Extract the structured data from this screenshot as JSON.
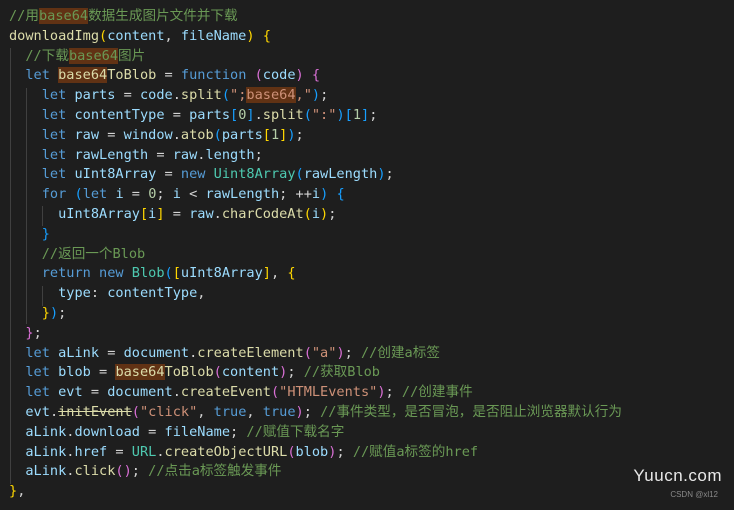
{
  "editor": {
    "theme_colors": {
      "background": "#1e1e1e",
      "keyword": "#569cd6",
      "variable": "#9cdcfe",
      "function": "#dcdcaa",
      "string": "#ce9178",
      "number": "#b5cea8",
      "comment": "#6a9955",
      "search_highlight": "#613214"
    },
    "lines": [
      [
        [
          "c",
          "//用"
        ],
        [
          "c hl",
          "base64"
        ],
        [
          "c",
          "数据生成图片文件并下载"
        ]
      ],
      [
        [
          "f",
          "downloadImg"
        ],
        [
          "b1",
          "("
        ],
        [
          "v",
          "content"
        ],
        [
          "p",
          ", "
        ],
        [
          "v",
          "fileName"
        ],
        [
          "b1",
          ")"
        ],
        [
          "p",
          " "
        ],
        [
          "b1",
          "{"
        ]
      ],
      [
        [
          "p",
          "  "
        ],
        [
          "c",
          "//下载"
        ],
        [
          "c hl",
          "base64"
        ],
        [
          "c",
          "图片"
        ]
      ],
      [
        [
          "p",
          "  "
        ],
        [
          "k",
          "let"
        ],
        [
          "p",
          " "
        ],
        [
          "f hl",
          "base64"
        ],
        [
          "f",
          "ToBlob"
        ],
        [
          "p",
          " = "
        ],
        [
          "k",
          "function"
        ],
        [
          "p",
          " "
        ],
        [
          "b2",
          "("
        ],
        [
          "v",
          "code"
        ],
        [
          "b2",
          ")"
        ],
        [
          "p",
          " "
        ],
        [
          "b2",
          "{"
        ]
      ],
      [
        [
          "p",
          "    "
        ],
        [
          "k",
          "let"
        ],
        [
          "p",
          " "
        ],
        [
          "v",
          "parts"
        ],
        [
          "p",
          " = "
        ],
        [
          "v",
          "code"
        ],
        [
          "p",
          "."
        ],
        [
          "f",
          "split"
        ],
        [
          "b3",
          "("
        ],
        [
          "s",
          "\";"
        ],
        [
          "s hl",
          "base64"
        ],
        [
          "s",
          ",\""
        ],
        [
          "b3",
          ")"
        ],
        [
          "p",
          ";"
        ]
      ],
      [
        [
          "p",
          "    "
        ],
        [
          "k",
          "let"
        ],
        [
          "p",
          " "
        ],
        [
          "v",
          "contentType"
        ],
        [
          "p",
          " = "
        ],
        [
          "v",
          "parts"
        ],
        [
          "b3",
          "["
        ],
        [
          "n",
          "0"
        ],
        [
          "b3",
          "]"
        ],
        [
          "p",
          "."
        ],
        [
          "f",
          "split"
        ],
        [
          "b3",
          "("
        ],
        [
          "s",
          "\":\""
        ],
        [
          "b3",
          ")"
        ],
        [
          "b3",
          "["
        ],
        [
          "n",
          "1"
        ],
        [
          "b3",
          "]"
        ],
        [
          "p",
          ";"
        ]
      ],
      [
        [
          "p",
          "    "
        ],
        [
          "k",
          "let"
        ],
        [
          "p",
          " "
        ],
        [
          "v",
          "raw"
        ],
        [
          "p",
          " = "
        ],
        [
          "v",
          "window"
        ],
        [
          "p",
          "."
        ],
        [
          "f",
          "atob"
        ],
        [
          "b3",
          "("
        ],
        [
          "v",
          "parts"
        ],
        [
          "b1",
          "["
        ],
        [
          "n",
          "1"
        ],
        [
          "b1",
          "]"
        ],
        [
          "b3",
          ")"
        ],
        [
          "p",
          ";"
        ]
      ],
      [
        [
          "p",
          "    "
        ],
        [
          "k",
          "let"
        ],
        [
          "p",
          " "
        ],
        [
          "v",
          "rawLength"
        ],
        [
          "p",
          " = "
        ],
        [
          "v",
          "raw"
        ],
        [
          "p",
          "."
        ],
        [
          "v",
          "length"
        ],
        [
          "p",
          ";"
        ]
      ],
      [
        [
          "p",
          "    "
        ],
        [
          "k",
          "let"
        ],
        [
          "p",
          " "
        ],
        [
          "v",
          "uInt8Array"
        ],
        [
          "p",
          " = "
        ],
        [
          "k",
          "new"
        ],
        [
          "p",
          " "
        ],
        [
          "t",
          "Uint8Array"
        ],
        [
          "b3",
          "("
        ],
        [
          "v",
          "rawLength"
        ],
        [
          "b3",
          ")"
        ],
        [
          "p",
          ";"
        ]
      ],
      [
        [
          "p",
          "    "
        ],
        [
          "k",
          "for"
        ],
        [
          "p",
          " "
        ],
        [
          "b3",
          "("
        ],
        [
          "k",
          "let"
        ],
        [
          "p",
          " "
        ],
        [
          "v",
          "i"
        ],
        [
          "p",
          " = "
        ],
        [
          "n",
          "0"
        ],
        [
          "p",
          "; "
        ],
        [
          "v",
          "i"
        ],
        [
          "p",
          " < "
        ],
        [
          "v",
          "rawLength"
        ],
        [
          "p",
          "; ++"
        ],
        [
          "v",
          "i"
        ],
        [
          "b3",
          ")"
        ],
        [
          "p",
          " "
        ],
        [
          "b3",
          "{"
        ]
      ],
      [
        [
          "p",
          "      "
        ],
        [
          "v",
          "uInt8Array"
        ],
        [
          "b1",
          "["
        ],
        [
          "v",
          "i"
        ],
        [
          "b1",
          "]"
        ],
        [
          "p",
          " = "
        ],
        [
          "v",
          "raw"
        ],
        [
          "p",
          "."
        ],
        [
          "f",
          "charCodeAt"
        ],
        [
          "b1",
          "("
        ],
        [
          "v",
          "i"
        ],
        [
          "b1",
          ")"
        ],
        [
          "p",
          ";"
        ]
      ],
      [
        [
          "p",
          "    "
        ],
        [
          "b3",
          "}"
        ]
      ],
      [
        [
          "p",
          "    "
        ],
        [
          "c",
          "//返回一个Blob"
        ]
      ],
      [
        [
          "p",
          "    "
        ],
        [
          "k",
          "return"
        ],
        [
          "p",
          " "
        ],
        [
          "k",
          "new"
        ],
        [
          "p",
          " "
        ],
        [
          "t",
          "Blob"
        ],
        [
          "b3",
          "("
        ],
        [
          "b1",
          "["
        ],
        [
          "v",
          "uInt8Array"
        ],
        [
          "b1",
          "]"
        ],
        [
          "p",
          ", "
        ],
        [
          "b1",
          "{"
        ]
      ],
      [
        [
          "p",
          "      "
        ],
        [
          "v",
          "type"
        ],
        [
          "p",
          ": "
        ],
        [
          "v",
          "contentType"
        ],
        [
          "p",
          ","
        ]
      ],
      [
        [
          "p",
          "    "
        ],
        [
          "b1",
          "}"
        ],
        [
          "b3",
          ")"
        ],
        [
          "p",
          ";"
        ]
      ],
      [
        [
          "p",
          "  "
        ],
        [
          "b2",
          "}"
        ],
        [
          "p",
          ";"
        ]
      ],
      [
        [
          "p",
          "  "
        ],
        [
          "k",
          "let"
        ],
        [
          "p",
          " "
        ],
        [
          "v",
          "aLink"
        ],
        [
          "p",
          " = "
        ],
        [
          "v",
          "document"
        ],
        [
          "p",
          "."
        ],
        [
          "f",
          "createElement"
        ],
        [
          "b2",
          "("
        ],
        [
          "s",
          "\"a\""
        ],
        [
          "b2",
          ")"
        ],
        [
          "p",
          "; "
        ],
        [
          "c",
          "//创建a标签"
        ]
      ],
      [
        [
          "p",
          "  "
        ],
        [
          "k",
          "let"
        ],
        [
          "p",
          " "
        ],
        [
          "v",
          "blob"
        ],
        [
          "p",
          " = "
        ],
        [
          "f hl",
          "base64"
        ],
        [
          "f",
          "ToBlob"
        ],
        [
          "b2",
          "("
        ],
        [
          "v",
          "content"
        ],
        [
          "b2",
          ")"
        ],
        [
          "p",
          "; "
        ],
        [
          "c",
          "//获取Blob"
        ]
      ],
      [
        [
          "p",
          "  "
        ],
        [
          "k",
          "let"
        ],
        [
          "p",
          " "
        ],
        [
          "v",
          "evt"
        ],
        [
          "p",
          " = "
        ],
        [
          "v",
          "document"
        ],
        [
          "p",
          "."
        ],
        [
          "f",
          "createEvent"
        ],
        [
          "b2",
          "("
        ],
        [
          "s",
          "\"HTMLEvents\""
        ],
        [
          "b2",
          ")"
        ],
        [
          "p",
          "; "
        ],
        [
          "c",
          "//创建事件"
        ]
      ],
      [
        [
          "p",
          "  "
        ],
        [
          "v",
          "evt"
        ],
        [
          "p",
          "."
        ],
        [
          "f del",
          "initEvent"
        ],
        [
          "b2",
          "("
        ],
        [
          "s",
          "\"click\""
        ],
        [
          "p",
          ", "
        ],
        [
          "k",
          "true"
        ],
        [
          "p",
          ", "
        ],
        [
          "k",
          "true"
        ],
        [
          "b2",
          ")"
        ],
        [
          "p",
          "; "
        ],
        [
          "c",
          "//事件类型，是否冒泡，是否阻止浏览器默认行为"
        ]
      ],
      [
        [
          "p",
          "  "
        ],
        [
          "v",
          "aLink"
        ],
        [
          "p",
          "."
        ],
        [
          "v",
          "download"
        ],
        [
          "p",
          " = "
        ],
        [
          "v",
          "fileName"
        ],
        [
          "p",
          "; "
        ],
        [
          "c",
          "//赋值下载名字"
        ]
      ],
      [
        [
          "p",
          "  "
        ],
        [
          "v",
          "aLink"
        ],
        [
          "p",
          "."
        ],
        [
          "v",
          "href"
        ],
        [
          "p",
          " = "
        ],
        [
          "t",
          "URL"
        ],
        [
          "p",
          "."
        ],
        [
          "f",
          "createObjectURL"
        ],
        [
          "b2",
          "("
        ],
        [
          "v",
          "blob"
        ],
        [
          "b2",
          ")"
        ],
        [
          "p",
          "; "
        ],
        [
          "c",
          "//赋值a标签的href"
        ]
      ],
      [
        [
          "p",
          "  "
        ],
        [
          "v",
          "aLink"
        ],
        [
          "p",
          "."
        ],
        [
          "f",
          "click"
        ],
        [
          "b2",
          "()"
        ],
        [
          "p",
          "; "
        ],
        [
          "c",
          "//点击a标签触发事件"
        ]
      ],
      [
        [
          "b1",
          "}"
        ],
        [
          "p",
          ","
        ]
      ]
    ]
  },
  "watermark": "Yuucn.com",
  "credit": "CSDN @xl12"
}
